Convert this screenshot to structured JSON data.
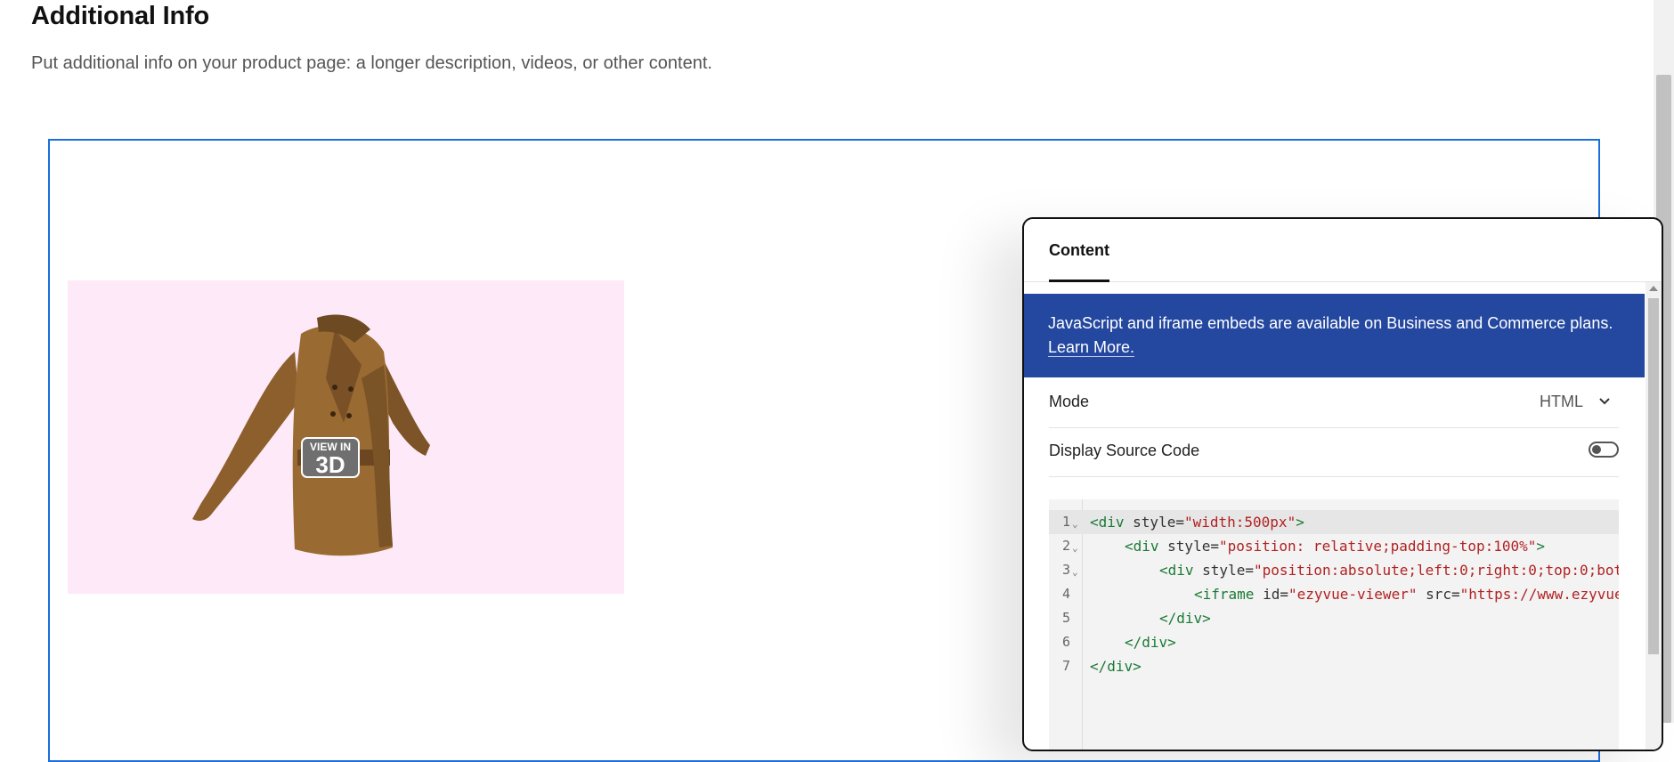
{
  "header": {
    "title": "Additional Info",
    "subtitle": "Put additional info on your product page: a longer description, videos, or other content."
  },
  "viewer": {
    "badge_top": "VIEW IN",
    "badge_bottom": "3D"
  },
  "panel": {
    "tab_label": "Content",
    "banner_text": "JavaScript and iframe embeds are available on Business and Commerce plans. ",
    "banner_link": "Learn More.",
    "mode_label": "Mode",
    "mode_value": "HTML",
    "source_label": "Display Source Code",
    "source_toggle_on": false
  },
  "code": {
    "lines": [
      {
        "number": "1",
        "fold": true
      },
      {
        "number": "2",
        "fold": true
      },
      {
        "number": "3",
        "fold": true
      },
      {
        "number": "4",
        "fold": false
      },
      {
        "number": "5",
        "fold": false
      },
      {
        "number": "6",
        "fold": false
      },
      {
        "number": "7",
        "fold": false
      }
    ],
    "tokens": {
      "l1_tag": "<div",
      "l1_attr": " style=",
      "l1_str": "\"width:500px\"",
      "l1_end": ">",
      "l2_tag": "<div",
      "l2_attr": " style=",
      "l2_str": "\"position: relative;padding-top:100%\"",
      "l2_end": ">",
      "l3_tag": "<div",
      "l3_attr": " style=",
      "l3_str": "\"position:absolute;left:0;right:0;top:0;bot",
      "l4_tag": "<iframe",
      "l4_attr": " id=",
      "l4_str": "\"ezyvue-viewer\"",
      "l4_attr2": " src=",
      "l4_str2": "\"https://www.ezyvue",
      "l5_tag": "</div>",
      "l6_tag": "</div>",
      "l7_tag": "</div>"
    }
  },
  "colors": {
    "accent": "#1a6fdb",
    "banner": "#2448a0",
    "viewer_bg": "#fde9f7",
    "code_tag": "#1a7a36",
    "code_string": "#b22222"
  }
}
